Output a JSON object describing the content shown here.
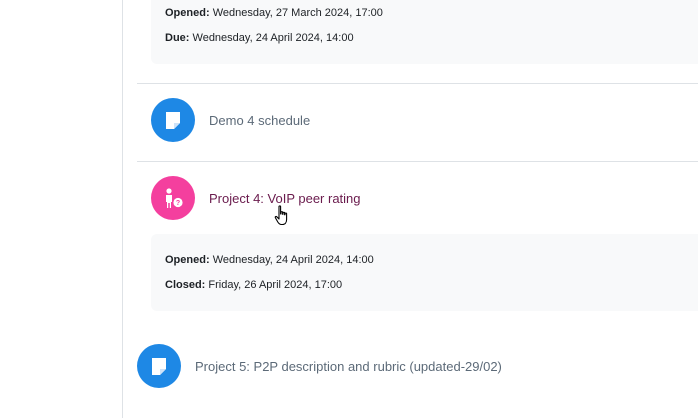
{
  "colors": {
    "resource_icon_bg": "#1e88e5",
    "workshop_icon_bg": "#f43f9e",
    "dates_box_bg": "#f8f9fa",
    "link_visited": "#6a1b4d",
    "link_default": "#5c6a78"
  },
  "top_dates": {
    "opened_label": "Opened:",
    "opened_value": "Wednesday, 27 March 2024, 17:00",
    "due_label": "Due:",
    "due_value": "Wednesday, 24 April 2024, 14:00"
  },
  "activities": [
    {
      "icon": "page-icon",
      "title": "Demo 4 schedule"
    },
    {
      "icon": "peer-rating-icon",
      "title": "Project 4: VoIP peer rating",
      "dates": {
        "opened_label": "Opened:",
        "opened_value": "Wednesday, 24 April 2024, 14:00",
        "closed_label": "Closed:",
        "closed_value": "Friday, 26 April 2024, 17:00"
      }
    },
    {
      "icon": "page-icon",
      "title": "Project 5: P2P description and rubric (updated-29/02)"
    }
  ]
}
